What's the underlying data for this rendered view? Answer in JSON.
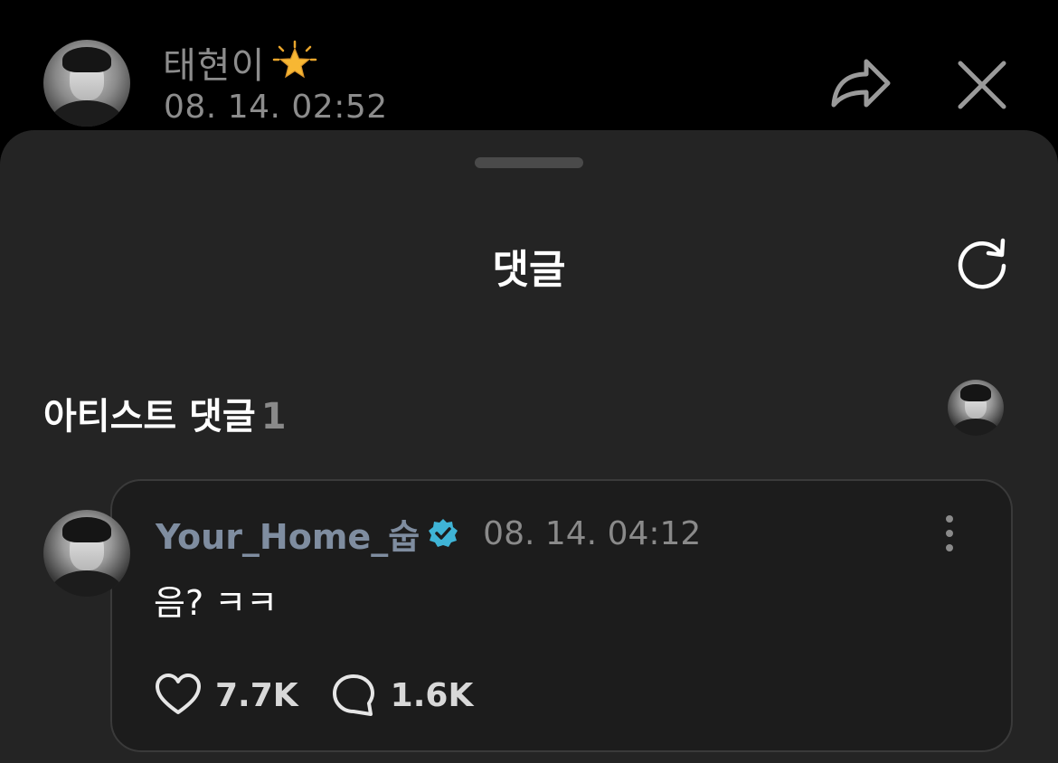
{
  "header": {
    "author_name": "태현이",
    "post_time": "08. 14. 02:52",
    "badge_icon": "star-icon",
    "share_icon": "share-icon",
    "close_icon": "close-icon"
  },
  "sheet": {
    "title": "댓글",
    "refresh_icon": "refresh-icon"
  },
  "artist_section": {
    "label": "아티스트 댓글",
    "count": "1"
  },
  "comment": {
    "author": "Your_Home_숩",
    "verified": true,
    "time": "08. 14. 04:12",
    "text": "음? ㅋㅋ",
    "likes": "7.7K",
    "replies": "1.6K"
  },
  "colors": {
    "background": "#000000",
    "sheet": "#242424",
    "card": "#1c1c1c",
    "muted_text": "#8c8c8c",
    "commenter_name": "#7f8da0",
    "verified_badge": "#3fb4d6",
    "star": "#f5b73a"
  }
}
